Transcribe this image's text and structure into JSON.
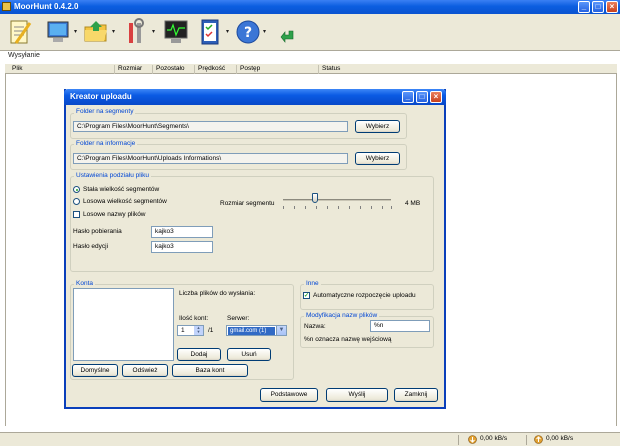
{
  "window": {
    "title": "MoorHunt 0.4.2.0"
  },
  "toolbar": {
    "icons": [
      "notepad-icon",
      "monitor-icon",
      "folder-icon",
      "tools-icon",
      "activity-monitor-icon",
      "checklist-icon",
      "help-icon",
      "download-arrow-icon"
    ]
  },
  "upload_section": {
    "label": "Wysyłanie"
  },
  "list": {
    "columns": [
      "Plik",
      "Rozmiar",
      "Pozostało",
      "Prędkość",
      "Postęp",
      "Status"
    ]
  },
  "statusbar": {
    "download_speed": "0,00 kB/s",
    "upload_speed": "0,00 kB/s"
  },
  "dialog": {
    "title": "Kreator uploadu",
    "segments_folder": {
      "label": "Folder na segmenty",
      "path": "C:\\Program Files\\MoorHunt\\Segments\\",
      "button": "Wybierz"
    },
    "info_folder": {
      "label": "Folder na informacje",
      "path": "C:\\Program Files\\MoorHunt\\Uploads Informations\\",
      "button": "Wybierz"
    },
    "split_settings": {
      "label": "Ustawienia podziału pliku",
      "radio_fixed": "Stała wielkość segmentów",
      "radio_random": "Losowa wielkość segmentów",
      "random_names": "Losowe nazwy plików",
      "segment_size_label": "Rozmiar segmentu",
      "segment_size_value": "4 MB",
      "download_password_label": "Hasło pobierania",
      "download_password": "kajko3",
      "edit_password_label": "Hasło edycji",
      "edit_password": "kajko3"
    },
    "accounts": {
      "label": "Konta",
      "files_to_send_label": "Liczba plików do wysłania:",
      "account_count_label": "Ilość kont:",
      "account_count": "1",
      "account_total": "/1",
      "server_label": "Serwer:",
      "server_value": "gmail.com (1)",
      "add_button": "Dodaj",
      "remove_button": "Usuń",
      "default_button": "Domyślne",
      "refresh_button": "Odśwież",
      "database_button": "Baza kont"
    },
    "other": {
      "label": "Inne",
      "auto_start": "Automatyczne rozpoczęcie uploadu"
    },
    "filename_mod": {
      "label": "Modyfikacja nazw plików",
      "name_label": "Nazwa:",
      "name_value": "%n",
      "hint": "%n oznacza nazwę wejściową"
    },
    "buttons": {
      "basic": "Podstawowe",
      "send": "Wyślij",
      "close": "Zamknij"
    }
  }
}
